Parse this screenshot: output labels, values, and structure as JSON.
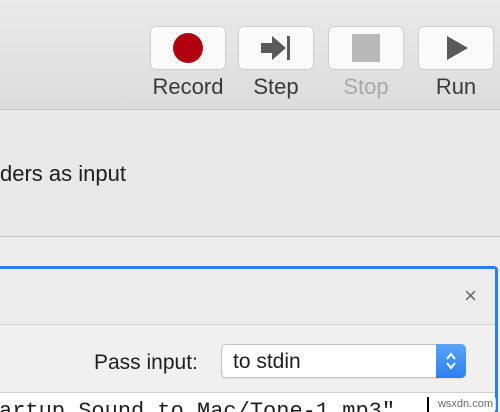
{
  "toolbar": {
    "record_label": "Record",
    "step_label": "Step",
    "stop_label": "Stop",
    "run_label": "Run"
  },
  "description": {
    "text": "ders as input"
  },
  "action_panel": {
    "close_symbol": "×",
    "pass_input_label": "Pass input:",
    "pass_input_value": "to stdin",
    "script_text": "artup Sound to Mac/Tone-1.mp3\""
  },
  "watermark": "wsxdn.com",
  "colors": {
    "record": "#b0000f",
    "focus_ring": "#2b7de9",
    "stepper": "#2c7ff0"
  },
  "icons": {
    "record": "record-circle-icon",
    "step": "step-forward-icon",
    "stop": "stop-square-icon",
    "run": "play-triangle-icon",
    "select": "up-down-chevron-icon"
  }
}
